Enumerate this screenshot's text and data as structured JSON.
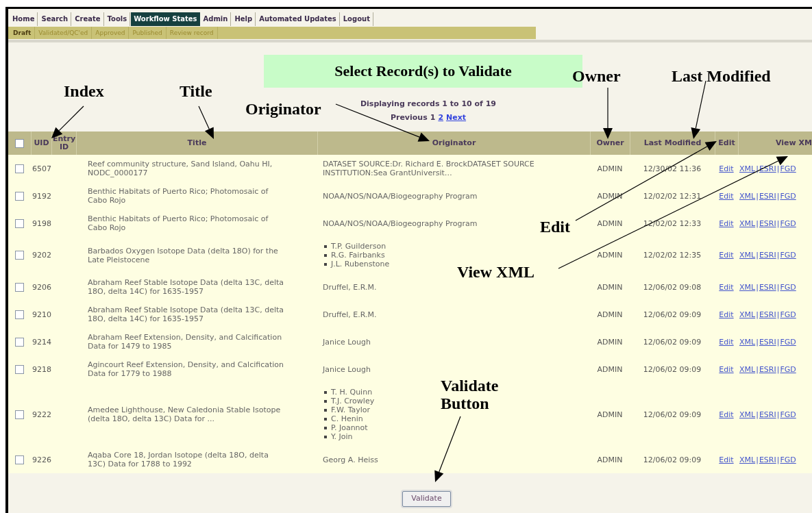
{
  "nav": {
    "items": [
      {
        "label": "Home",
        "selected": false
      },
      {
        "label": "Search",
        "selected": false
      },
      {
        "label": "Create",
        "selected": false
      },
      {
        "label": "Tools",
        "selected": false
      },
      {
        "label": "Workflow States",
        "selected": true
      },
      {
        "label": "Admin",
        "selected": false
      },
      {
        "label": "Help",
        "selected": false
      },
      {
        "label": "Automated Updates",
        "selected": false
      },
      {
        "label": "Logout",
        "selected": false
      }
    ]
  },
  "subnav": {
    "items": [
      {
        "label": "Draft",
        "selected": true
      },
      {
        "label": "Validated/QC'ed",
        "selected": false
      },
      {
        "label": "Approved",
        "selected": false
      },
      {
        "label": "Published",
        "selected": false
      },
      {
        "label": "Review record",
        "selected": false
      }
    ]
  },
  "heading": "Select Record(s) to Validate",
  "pagination": {
    "summary": "Displaying records 1 to 10 of 19",
    "links": [
      {
        "label": "Previous",
        "kind": "text"
      },
      {
        "label": "1",
        "kind": "text"
      },
      {
        "label": "2",
        "kind": "link"
      },
      {
        "label": "Next",
        "kind": "link"
      }
    ]
  },
  "table": {
    "select_all": {
      "checked": false
    },
    "columns": [
      "UID",
      "Entry ID",
      "Title",
      "Originator",
      "Owner",
      "Last Modified",
      "Edit",
      "View XM"
    ],
    "separator": "|",
    "rows": [
      {
        "checked": false,
        "uid": "6507",
        "title": "Reef community structure, Sand Island, Oahu HI, NODC_0000177",
        "originator": [
          "DATASET SOURCE:Dr. Richard E. BrockDATASET SOURCE INSTITUTION:Sea GrantUniversit…"
        ],
        "owner": "ADMIN",
        "modified": "12/30/02 11:36",
        "edit": "Edit",
        "views": [
          "XML",
          "ESRI",
          "FGD"
        ]
      },
      {
        "checked": false,
        "uid": "9192",
        "title": "Benthic Habitats of Puerto Rico; Photomosaic of Cabo Rojo",
        "originator": [
          "NOAA/NOS/NOAA/Biogeography Program"
        ],
        "owner": "ADMIN",
        "modified": "12/02/02 12:31",
        "edit": "Edit",
        "views": [
          "XML",
          "ESRI",
          "FGD"
        ]
      },
      {
        "checked": false,
        "uid": "9198",
        "title": "Benthic Habitats of Puerto Rico; Photomosaic of Cabo Rojo",
        "originator": [
          "NOAA/NOS/NOAA/Biogeography Program"
        ],
        "owner": "ADMIN",
        "modified": "12/02/02 12:33",
        "edit": "Edit",
        "views": [
          "XML",
          "ESRI",
          "FGD"
        ]
      },
      {
        "checked": false,
        "uid": "9202",
        "title": "Barbados Oxygen Isotope Data (delta 18O) for the Late Pleistocene",
        "originator": [
          "T.P. Guilderson",
          "R.G. Fairbanks",
          "J.L. Rubenstone"
        ],
        "owner": "ADMIN",
        "modified": "12/02/02 12:35",
        "edit": "Edit",
        "views": [
          "XML",
          "ESRI",
          "FGD"
        ]
      },
      {
        "checked": false,
        "uid": "9206",
        "title": "Abraham Reef Stable Isotope Data (delta 13C, delta 18O, delta 14C) for 1635-1957",
        "originator": [
          "Druffel, E.R.M."
        ],
        "owner": "ADMIN",
        "modified": "12/06/02 09:08",
        "edit": "Edit",
        "views": [
          "XML",
          "ESRI",
          "FGD"
        ]
      },
      {
        "checked": false,
        "uid": "9210",
        "title": "Abraham Reef Stable Isotope Data (delta 13C, delta 18O, delta 14C) for 1635-1957",
        "originator": [
          "Druffel, E.R.M."
        ],
        "owner": "ADMIN",
        "modified": "12/06/02 09:09",
        "edit": "Edit",
        "views": [
          "XML",
          "ESRI",
          "FGD"
        ]
      },
      {
        "checked": false,
        "uid": "9214",
        "title": "Abraham Reef Extension, Density, and Calcification Data for 1479 to 1985",
        "originator": [
          "Janice Lough"
        ],
        "owner": "ADMIN",
        "modified": "12/06/02 09:09",
        "edit": "Edit",
        "views": [
          "XML",
          "ESRI",
          "FGD"
        ]
      },
      {
        "checked": false,
        "uid": "9218",
        "title": "Agincourt Reef Extension, Density, and Calcification Data for 1779 to 1988",
        "originator": [
          "Janice Lough"
        ],
        "owner": "ADMIN",
        "modified": "12/06/02 09:09",
        "edit": "Edit",
        "views": [
          "XML",
          "ESRI",
          "FGD"
        ]
      },
      {
        "checked": false,
        "uid": "9222",
        "title": "Amedee Lighthouse, New Caledonia Stable Isotope (delta 18O, delta 13C) Data for ...",
        "originator": [
          "T. H. Quinn",
          "T.J. Crowley",
          "F.W. Taylor",
          "C. Henin",
          "P. Joannot",
          "Y. Join"
        ],
        "owner": "ADMIN",
        "modified": "12/06/02 09:09",
        "edit": "Edit",
        "views": [
          "XML",
          "ESRI",
          "FGD"
        ]
      },
      {
        "checked": false,
        "uid": "9226",
        "title": "Aqaba Core 18, Jordan Isotope (delta 18O, delta 13C) Data for 1788 to 1992",
        "originator": [
          "Georg A. Heiss"
        ],
        "owner": "ADMIN",
        "modified": "12/06/02 09:09",
        "edit": "Edit",
        "views": [
          "XML",
          "ESRI",
          "FGD"
        ]
      }
    ]
  },
  "validate_button": "Validate",
  "annotations": [
    {
      "text": "Index"
    },
    {
      "text": "Title"
    },
    {
      "text": "Originator"
    },
    {
      "text": "Owner"
    },
    {
      "text": "Last Modified"
    },
    {
      "text": "Edit"
    },
    {
      "text": "View XML"
    },
    {
      "text": "Validate Button"
    }
  ]
}
